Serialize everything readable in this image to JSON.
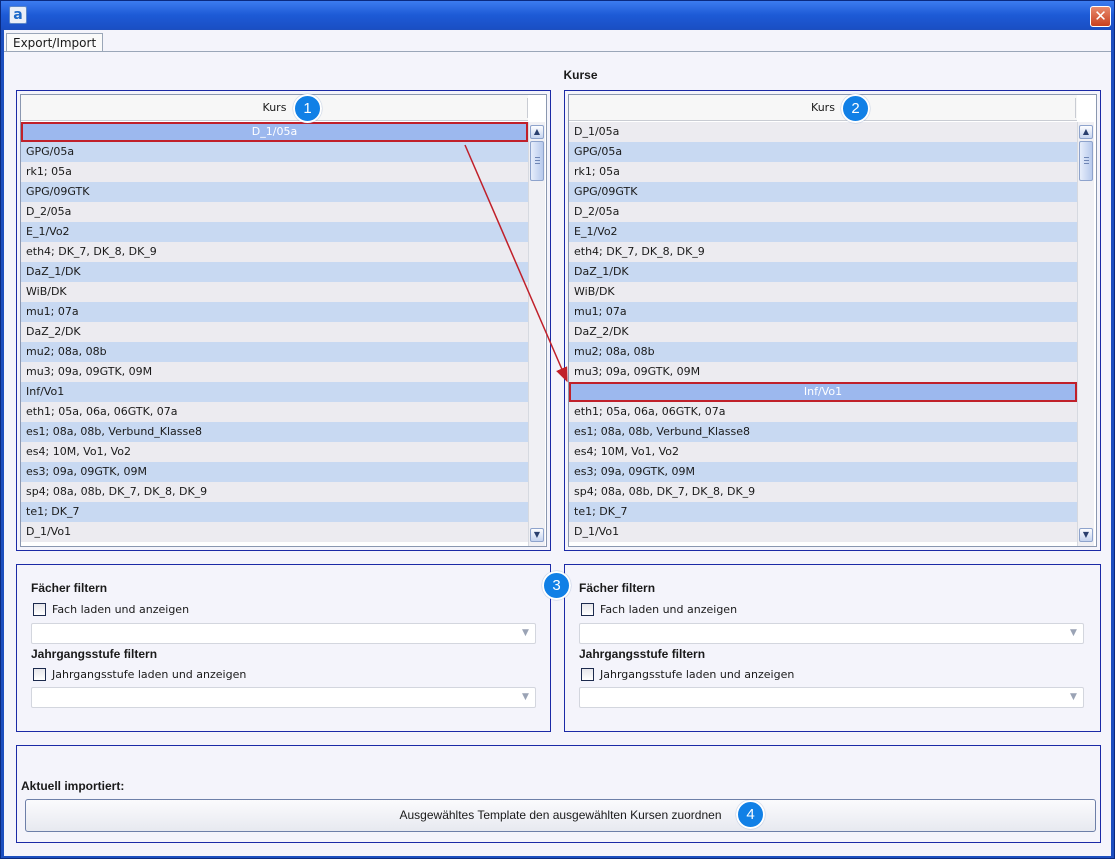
{
  "window": {
    "app_icon_letter": "a",
    "close_glyph": "✕"
  },
  "tabs": [
    {
      "label": "Export/Import"
    }
  ],
  "section_title": "Kurse",
  "left_list": {
    "header": "Kurs",
    "selected_index": 0,
    "rows": [
      "D_1/05a",
      "GPG/05a",
      "rk1; 05a",
      "GPG/09GTK",
      "D_2/05a",
      "E_1/Vo2",
      "eth4; DK_7, DK_8, DK_9",
      "DaZ_1/DK",
      "WiB/DK",
      "mu1; 07a",
      "DaZ_2/DK",
      "mu2; 08a, 08b",
      "mu3; 09a, 09GTK, 09M",
      "Inf/Vo1",
      "eth1; 05a, 06a, 06GTK, 07a",
      "es1; 08a, 08b, Verbund_Klasse8",
      "es4; 10M, Vo1, Vo2",
      "es3; 09a, 09GTK, 09M",
      "sp4; 08a, 08b, DK_7, DK_8, DK_9",
      "te1; DK_7",
      "D_1/Vo1"
    ]
  },
  "right_list": {
    "header": "Kurs",
    "selected_index": 13,
    "rows": [
      "D_1/05a",
      "GPG/05a",
      "rk1; 05a",
      "GPG/09GTK",
      "D_2/05a",
      "E_1/Vo2",
      "eth4; DK_7, DK_8, DK_9",
      "DaZ_1/DK",
      "WiB/DK",
      "mu1; 07a",
      "DaZ_2/DK",
      "mu2; 08a, 08b",
      "mu3; 09a, 09GTK, 09M",
      "Inf/Vo1",
      "eth1; 05a, 06a, 06GTK, 07a",
      "es1; 08a, 08b, Verbund_Klasse8",
      "es4; 10M, Vo1, Vo2",
      "es3; 09a, 09GTK, 09M",
      "sp4; 08a, 08b, DK_7, DK_8, DK_9",
      "te1; DK_7",
      "D_1/Vo1"
    ]
  },
  "filters": {
    "subject_title": "Fächer filtern",
    "subject_checkbox": "Fach laden und anzeigen",
    "subject_checked": false,
    "grade_title": "Jahrgangsstufe filtern",
    "grade_checkbox": "Jahrgangsstufe laden und anzeigen",
    "grade_checked": false
  },
  "bottom": {
    "status_label": "Aktuell importiert:",
    "assign_button": "Ausgewähltes Template den ausgewählten Kursen zuordnen"
  },
  "badges": [
    "1",
    "2",
    "3",
    "4"
  ],
  "colors": {
    "badge": "#1180e6",
    "highlight": "#c0202a",
    "row_even": "#c8d9f2",
    "row_odd": "#ecebf0",
    "selected_row": "#9cb8ee"
  }
}
